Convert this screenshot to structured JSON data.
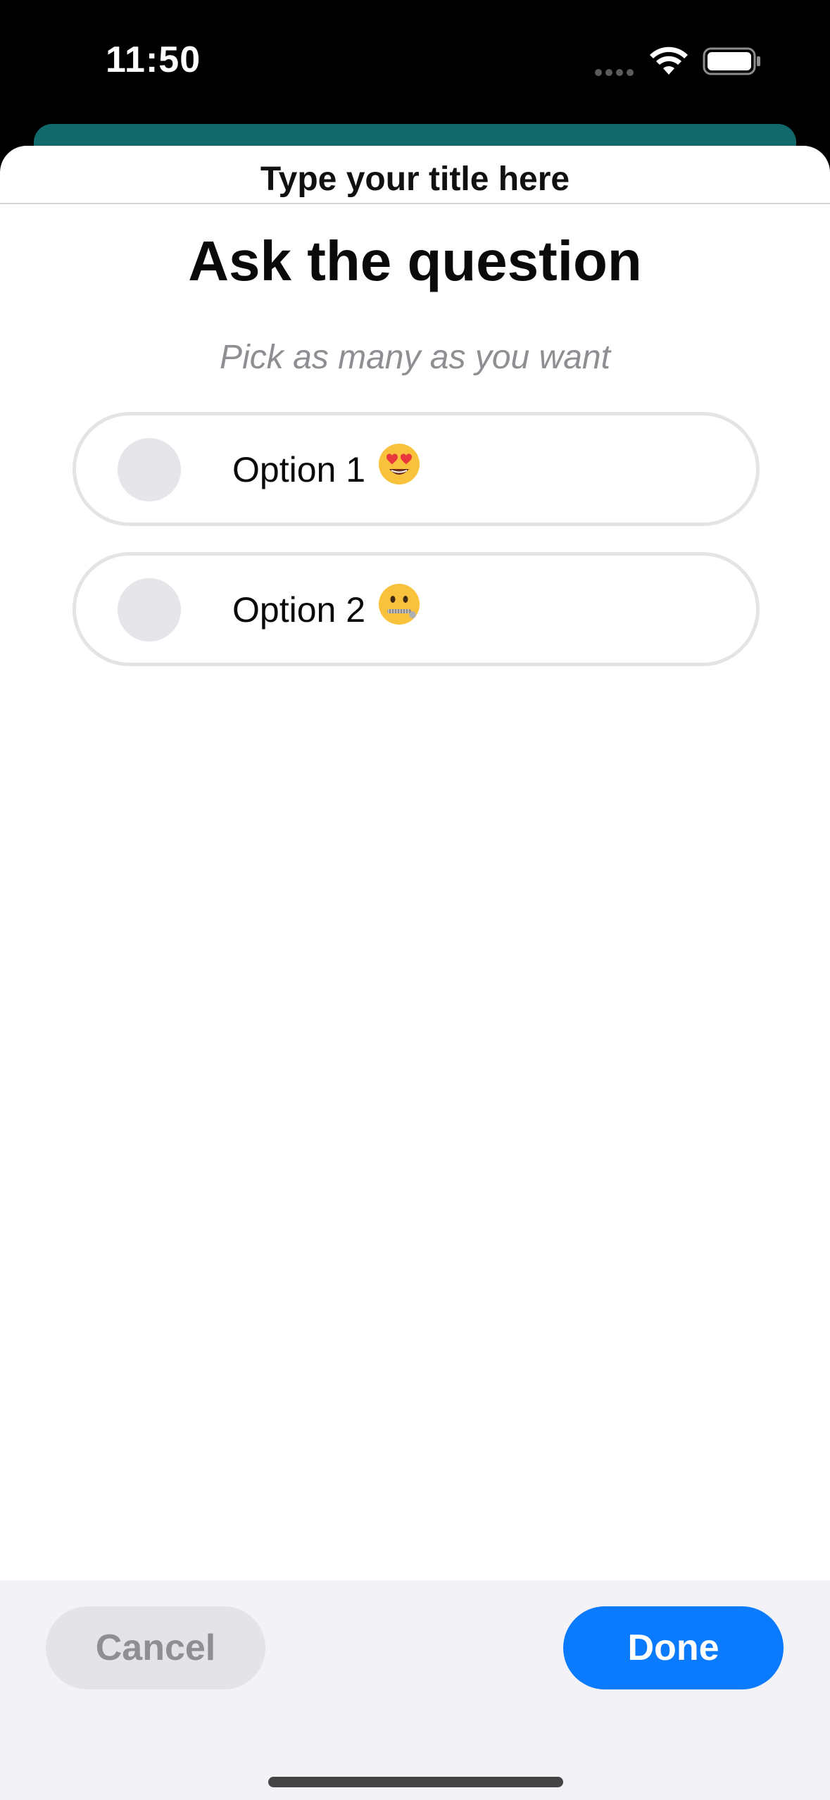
{
  "status_bar": {
    "time": "11:50"
  },
  "sheet": {
    "title": "Type your title here"
  },
  "question": {
    "text": "Ask the question",
    "hint": "Pick as many as you want"
  },
  "options": [
    {
      "label": "Option 1",
      "emoji": "smiling-face-with-heart-eyes"
    },
    {
      "label": "Option 2",
      "emoji": "zipper-mouth-face"
    }
  ],
  "actions": {
    "cancel_label": "Cancel",
    "done_label": "Done"
  },
  "colors": {
    "accent": "#0a7aff",
    "teal_header": "#11696b"
  }
}
